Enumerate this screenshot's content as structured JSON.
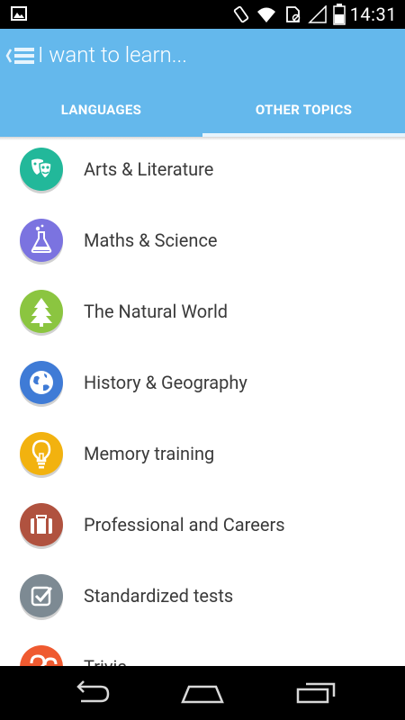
{
  "status_bar": {
    "time": "14:31",
    "icons": [
      "image-icon",
      "rotate-phone-icon",
      "wifi-icon",
      "sim-icon",
      "signal-icon",
      "battery-icon"
    ]
  },
  "app_bar": {
    "title": "I want to learn...",
    "back_icon": "back-menu-icon"
  },
  "tabs": [
    {
      "label": "LANGUAGES",
      "selected": false
    },
    {
      "label": "OTHER TOPICS",
      "selected": true
    }
  ],
  "topics": [
    {
      "label": "Arts & Literature",
      "icon": "theater-masks-icon",
      "color": "#22b89a"
    },
    {
      "label": "Maths & Science",
      "icon": "flask-icon",
      "color": "#7b73e0"
    },
    {
      "label": "The Natural World",
      "icon": "tree-icon",
      "color": "#8bc540"
    },
    {
      "label": "History & Geography",
      "icon": "globe-icon",
      "color": "#3f7bd6"
    },
    {
      "label": "Memory training",
      "icon": "lightbulb-icon",
      "color": "#f2b20f"
    },
    {
      "label": "Professional and Careers",
      "icon": "briefcase-icon",
      "color": "#b0523f"
    },
    {
      "label": "Standardized tests",
      "icon": "checkbox-icon",
      "color": "#7d8a93"
    },
    {
      "label": "Trivia",
      "icon": "question-icon",
      "color": "#ef5a30"
    }
  ],
  "nav_bar": {
    "icons": [
      "back-nav-icon",
      "home-nav-icon",
      "recents-nav-icon"
    ]
  },
  "colors": {
    "primary": "#64b8ec",
    "tab_indicator": "#e6f4fd",
    "text": "#3a3a3a"
  }
}
